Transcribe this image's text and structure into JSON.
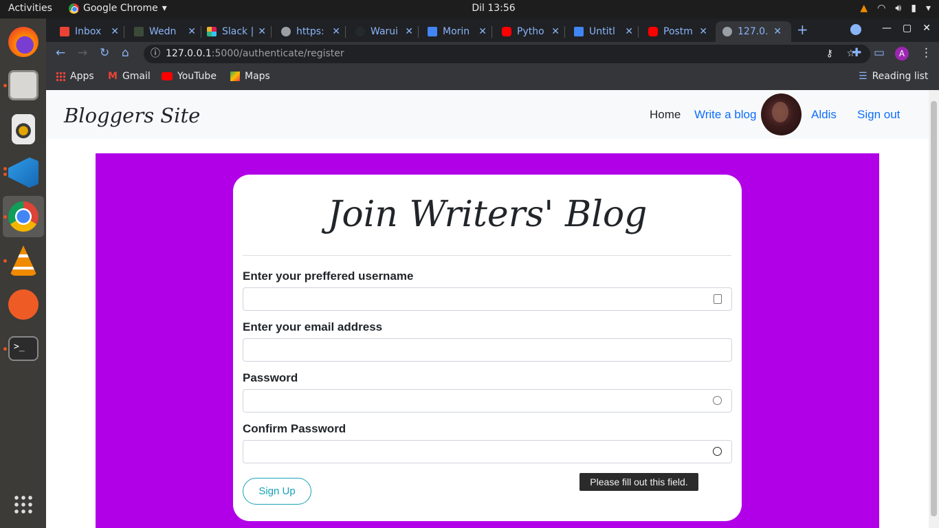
{
  "system_bar": {
    "activities": "Activities",
    "app_name": "Google Chrome",
    "clock": "Dil 13:56"
  },
  "tabs": [
    {
      "label": "Inbox",
      "favicon": "gmail-icon",
      "color": "#ea4335"
    },
    {
      "label": "Wedn",
      "favicon": "tree-icon",
      "color": "#3c4a3a"
    },
    {
      "label": "Slack |",
      "favicon": "slack-icon",
      "color": "#e01e5a"
    },
    {
      "label": "https:",
      "favicon": "globe-icon",
      "color": "#9aa0a6"
    },
    {
      "label": "Warui",
      "favicon": "github-icon",
      "color": "#24292e"
    },
    {
      "label": "Morin",
      "favicon": "calendar-icon",
      "color": "#4285f4"
    },
    {
      "label": "Pytho",
      "favicon": "youtube-icon",
      "color": "#ff0000"
    },
    {
      "label": "Untitl",
      "favicon": "docs-icon",
      "color": "#4285f4"
    },
    {
      "label": "Postm",
      "favicon": "youtube-icon",
      "color": "#ff0000"
    },
    {
      "label": "127.0.",
      "favicon": "globe-icon",
      "color": "#9aa0a6"
    }
  ],
  "address": {
    "host": "127.0.0.1",
    "path": ":5000/authenticate/register"
  },
  "bookmarks": {
    "apps": "Apps",
    "gmail": "Gmail",
    "youtube": "YouTube",
    "maps": "Maps",
    "reading_list": "Reading list"
  },
  "site": {
    "brand": "Bloggers Site",
    "nav": {
      "home": "Home",
      "write": "Write a blog",
      "user": "Aldis",
      "signout": "Sign out"
    }
  },
  "form": {
    "title": "Join Writers' Blog",
    "username_label": "Enter your preffered username",
    "email_label": "Enter your email address",
    "password_label": "Password",
    "confirm_label": "Confirm Password",
    "submit": "Sign Up",
    "tooltip": "Please fill out this field."
  },
  "colors": {
    "accent_purple": "#b100e8",
    "button_teal": "#17a2b8",
    "link_blue": "#0d6efd"
  }
}
